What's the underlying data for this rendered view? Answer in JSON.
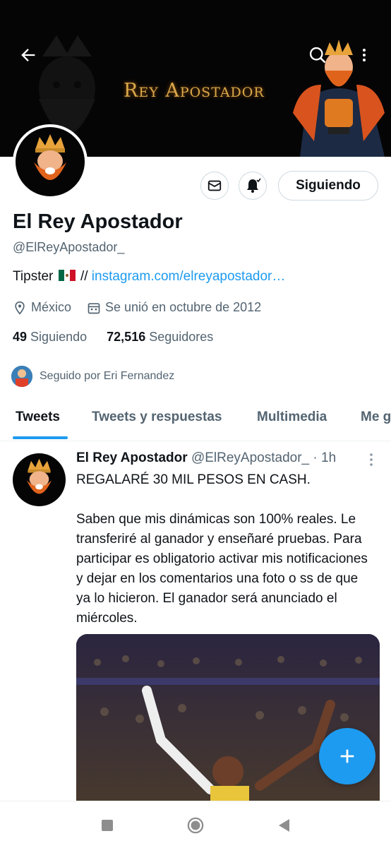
{
  "banner": {
    "title": "Rey Apostador"
  },
  "profile": {
    "name": "El Rey Apostador",
    "handle": "@ElReyApostador_",
    "bio_prefix": "Tipster",
    "bio_sep": "//",
    "bio_link": "instagram.com/elreyapostador…",
    "location": "México",
    "joined": "Se unió en octubre de 2012",
    "following_count": "49",
    "following_label": "Siguiendo",
    "followers_count": "72,516",
    "followers_label": "Seguidores",
    "followed_by": "Seguido por Eri Fernandez"
  },
  "actions": {
    "follow_label": "Siguiendo"
  },
  "tabs": [
    {
      "label": "Tweets"
    },
    {
      "label": "Tweets y respuestas"
    },
    {
      "label": "Multimedia"
    },
    {
      "label": "Me g"
    }
  ],
  "tweet": {
    "author": "El Rey Apostador",
    "handle": "@ElReyApostador_",
    "dot": "·",
    "time": "1h",
    "line1": "REGALARÉ 30 MIL PESOS EN CASH.",
    "paragraph": "Saben que mis dinámicas son 100% reales. Le transferiré al ganador y enseñaré pruebas. Para participar es obligatorio activar mis notificaciones y dejar en los comentarios una foto o ss de que ya lo hicieron. El ganador será anunciado el miércoles."
  },
  "colors": {
    "accent": "#1d9bf0",
    "text": "#0f1419",
    "muted": "#536471",
    "banner_gold": "#d9a84a"
  },
  "icons": [
    "back-arrow-icon",
    "search-icon",
    "more-vertical-icon",
    "mail-icon",
    "bell-icon",
    "location-icon",
    "calendar-icon",
    "compose-icon",
    "square-nav-icon",
    "home-circle-nav-icon",
    "back-triangle-nav-icon"
  ]
}
